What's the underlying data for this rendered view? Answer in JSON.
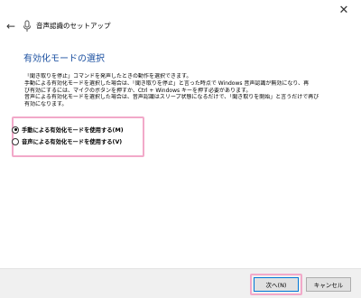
{
  "window": {
    "title": "音声認識のセットアップ",
    "close_symbol": "✕",
    "back_symbol": "←"
  },
  "page": {
    "title": "有効化モードの選択",
    "description_lines": [
      "「聞き取りを停止」コマンドを発声したときの動作を選択できます。",
      "手動による有効化モードを選択した場合は、「聞き取りを停止」と言った時点で Windows 音声認識が無効になり、再",
      "び有効にするには、マイクのボタンを押すか、Ctrl + Windows キーを押す必要があります。",
      "音声による有効化モードを選択した場合は、音声認識はスリープ状態になるだけで、「聞き取りを開始」と言うだけで再び",
      "有効になります。"
    ]
  },
  "options": [
    {
      "label": "手動による有効化モードを使用する(M)",
      "checked": true
    },
    {
      "label": "音声による有効化モードを使用する(V)",
      "checked": false
    }
  ],
  "buttons": {
    "next": "次へ(N)",
    "cancel": "キャンセル"
  },
  "colors": {
    "accent_title": "#1a4fa0",
    "highlight": "#f2a9c9",
    "footer_bg": "#f0f0f0"
  }
}
